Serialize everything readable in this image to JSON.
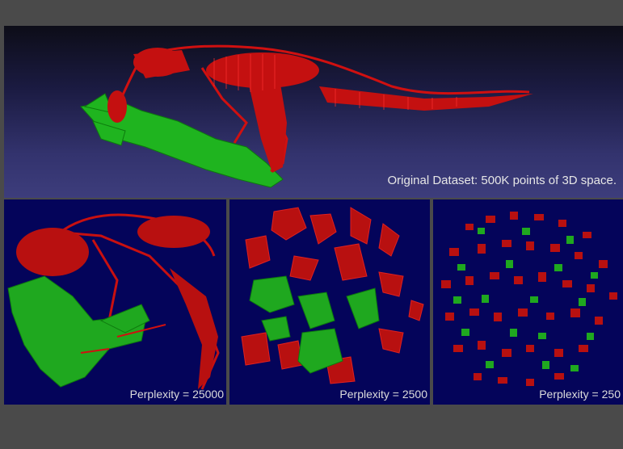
{
  "original": {
    "caption": "Original Dataset: 500K points of 3D space."
  },
  "panels": [
    {
      "caption": "Perplexity = 25000"
    },
    {
      "caption": "Perplexity = 2500"
    },
    {
      "caption": "Perplexity = 250"
    }
  ],
  "colors": {
    "red_points": "#d01010",
    "green_points": "#12c012",
    "background_dark": "#04045a",
    "page_background": "#4a4a4a"
  }
}
